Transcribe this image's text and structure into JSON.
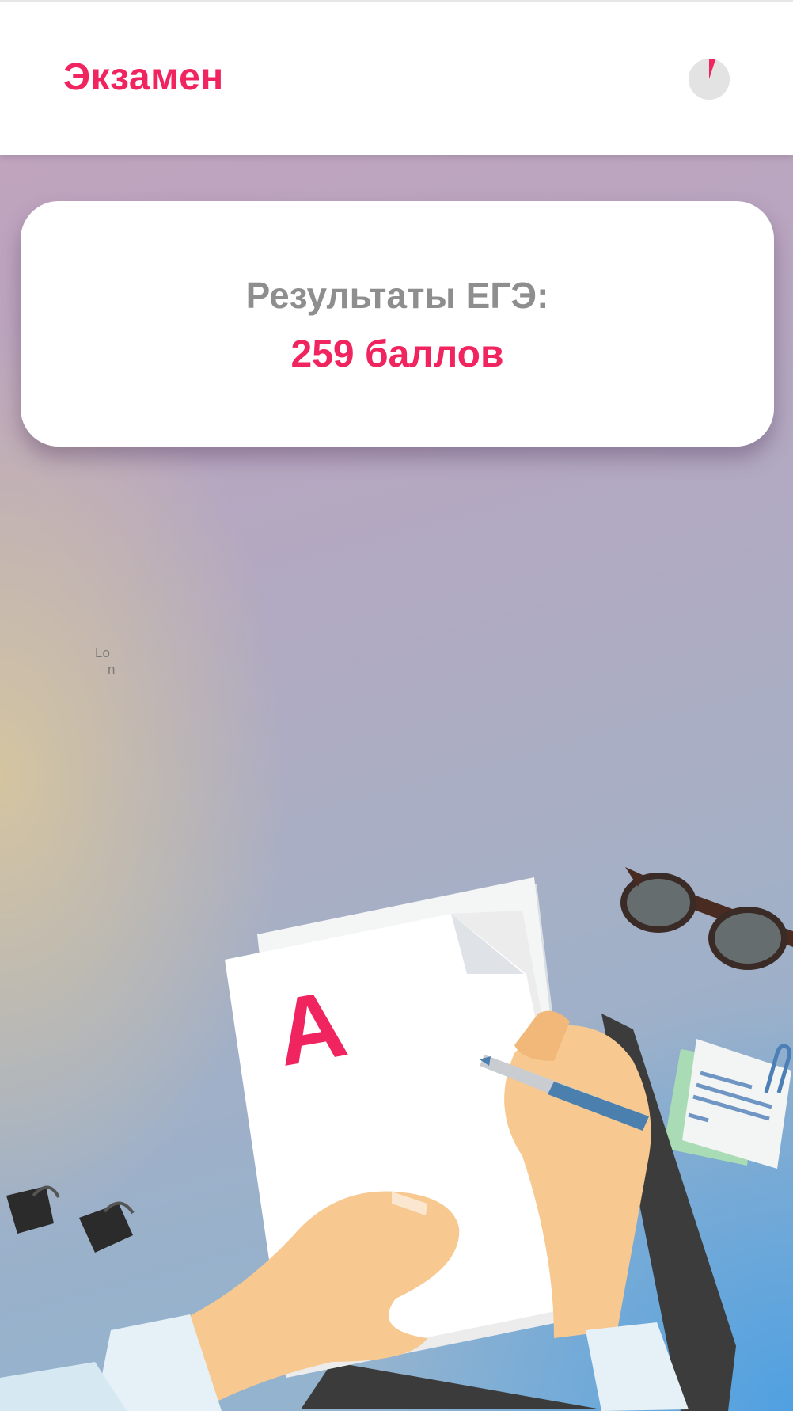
{
  "header": {
    "title": "Экзамен",
    "timer_icon": "pie-timer-icon",
    "timer_progress": 0.05
  },
  "result_card": {
    "label": "Результаты ЕГЭ:",
    "score": "259 баллов"
  },
  "loading": {
    "line1": "Lo",
    "line2": "n"
  },
  "illustration": {
    "grade_letter": "A",
    "icons": [
      "sunglasses-icon",
      "binder-clip-icon",
      "sticky-note-icon",
      "paperclip-icon",
      "pen-icon"
    ]
  },
  "colors": {
    "accent": "#f0245f",
    "label_gray": "#8e8e8e",
    "card_bg": "#ffffff"
  }
}
